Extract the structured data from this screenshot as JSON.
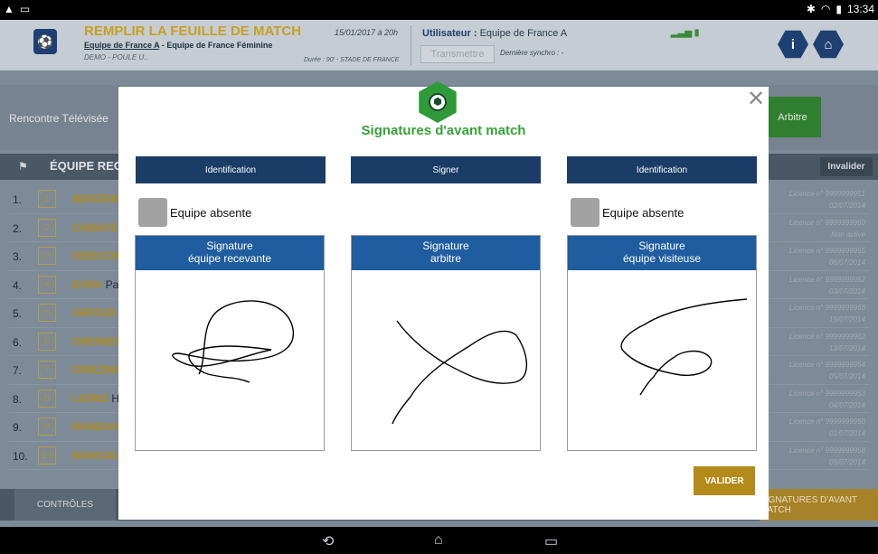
{
  "statusbar": {
    "left_icons": [
      "warning-icon",
      "screenshot-icon"
    ],
    "time": "13:34"
  },
  "header": {
    "title": "REMPLIR LA FEUILLE DE MATCH",
    "team_home": "Equipe de France A",
    "team_sep": " - ",
    "team_away": "Equipe de France Féminine",
    "poule": "DEMO - POULE U..",
    "date": "15/01/2017 à 20h",
    "duree": "Durée : 90' - STADE DE FRANCE",
    "user_label": "Utilisateur :",
    "user_value": " Equipe de France A",
    "transmit_label": "Transmettre",
    "sync_label": "Dernière synchro : -",
    "info_label": "i",
    "home_label": "⌂"
  },
  "background": {
    "rencontre_label": "Rencontre Télévisée",
    "arbitre_label": "Arbitre",
    "equipe_label": "ÉQUIPE RECEVANTE",
    "invalider_label": "Invalider",
    "players": [
      {
        "idx": "1.",
        "num": "1",
        "name": "BENZEMA",
        "first": "",
        "lic": "Licence n° 9999999951",
        "date": "02/07/2014"
      },
      {
        "idx": "2.",
        "num": "2",
        "name": "CABAYE",
        "first": "",
        "lic": "Licence n° 9999999960",
        "date": "Non active"
      },
      {
        "idx": "3.",
        "num": "3",
        "name": "DEBUCHY",
        "first": "",
        "lic": "Licence n° 9999999955",
        "date": "06/07/2014"
      },
      {
        "idx": "4.",
        "num": "4",
        "name": "EVRA",
        "first": " Pa",
        "lic": "Licence n° 9999999952",
        "date": "03/07/2014"
      },
      {
        "idx": "5.",
        "num": "5",
        "name": "GIROUD",
        "first": "",
        "lic": "Licence n° 9999999966",
        "date": "15/07/2014"
      },
      {
        "idx": "6.",
        "num": "6",
        "name": "GRENIER",
        "first": "",
        "lic": "Licence n° 9999999962",
        "date": "13/07/2014"
      },
      {
        "idx": "7.",
        "num": "7",
        "name": "GRIEZMANN",
        "first": "",
        "lic": "Licence n° 9999999954",
        "date": "05/07/2014"
      },
      {
        "idx": "8.",
        "num": "8",
        "name": "LIORIS",
        "first": " H",
        "lic": "Licence n° 9999999953",
        "date": "04/07/2014"
      },
      {
        "idx": "9.",
        "num": "9",
        "name": "MANDANDA",
        "first": "",
        "lic": "Licence n° 9999999950",
        "date": "01/07/2014"
      },
      {
        "idx": "10.",
        "num": "10",
        "name": "MANGALA",
        "first": "",
        "lic": "Licence n° 9999999958",
        "date": "09/07/2014"
      }
    ],
    "controles_label": "CONTRÔLES",
    "signatures_label": "SIGNATURES D'AVANT MATCH"
  },
  "modal": {
    "title": "Signatures d'avant match",
    "close_label": "✕",
    "col_left_button": "Identification",
    "col_mid_button": "Signer",
    "col_right_button": "Identification",
    "absent_left": "Equipe absente",
    "absent_right": "Equipe absente",
    "sig_left_line1": "Signature",
    "sig_left_line2": "équipe recevante",
    "sig_mid_line1": "Signature",
    "sig_mid_line2": "arbitre",
    "sig_right_line1": "Signature",
    "sig_right_line2": "équipe visiteuse",
    "valider_label": "VALIDER"
  },
  "navbar": {
    "back": "back-icon",
    "home": "home-icon",
    "recents": "recents-icon"
  }
}
